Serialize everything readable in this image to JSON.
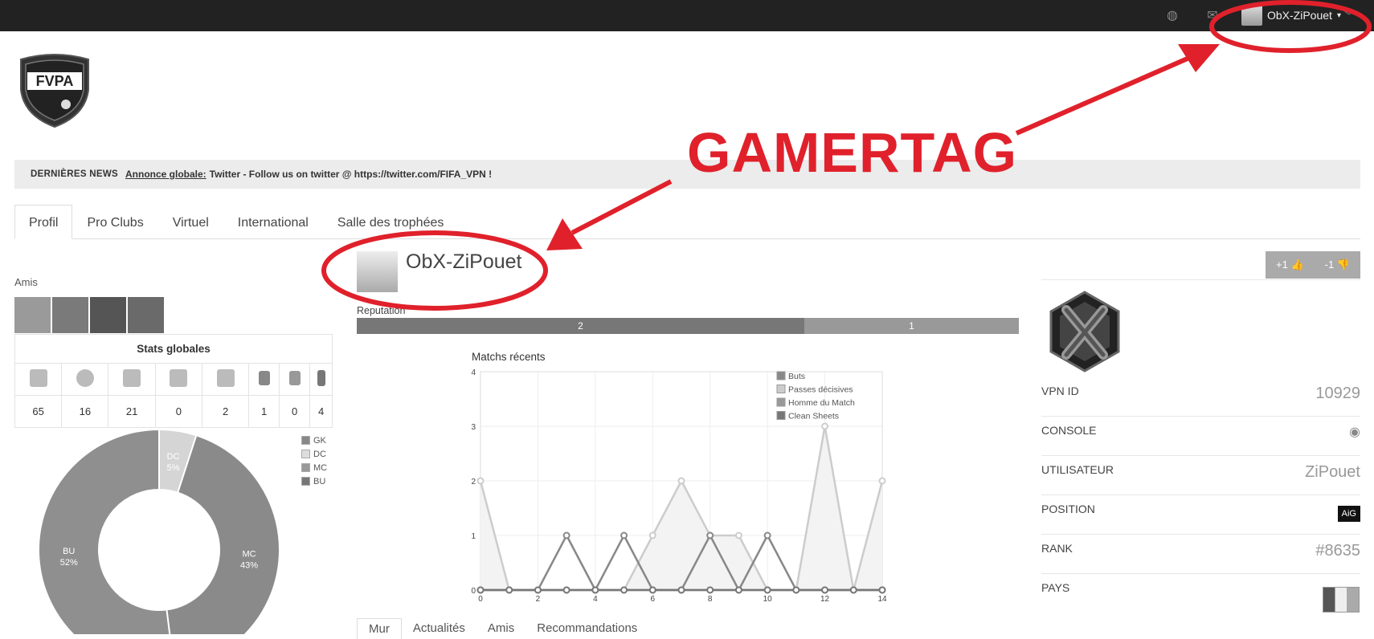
{
  "topbar": {
    "username": "ObX-ZiPouet",
    "caret": "▾"
  },
  "news": {
    "label": "DERNIÈRES NEWS",
    "prefix": "Annonce globale:",
    "text": "Twitter - Follow us on twitter @ https://twitter.com/FIFA_VPN !"
  },
  "tabs": [
    "Profil",
    "Pro Clubs",
    "Virtuel",
    "International",
    "Salle des trophées"
  ],
  "friends": {
    "label": "Amis"
  },
  "stats": {
    "title": "Stats globales",
    "values": [
      "65",
      "16",
      "21",
      "0",
      "2",
      "1",
      "0",
      "4"
    ]
  },
  "donut": {
    "legend": [
      "GK",
      "DC",
      "MC",
      "BU"
    ],
    "slices": [
      {
        "label": "DC",
        "pct": "5%",
        "value": 5,
        "color": "#d5d5d5"
      },
      {
        "label": "MC",
        "pct": "43%",
        "value": 43,
        "color": "#8a8a8a"
      },
      {
        "label": "BU",
        "pct": "52%",
        "value": 52,
        "color": "#8f8f8f"
      }
    ]
  },
  "profile": {
    "name": "ObX-ZiPouet",
    "reputation_label": "Reputation",
    "rep_pos": "2",
    "rep_neg": "1"
  },
  "chart_data": {
    "type": "line",
    "title": "Matchs récents",
    "xlim": [
      0,
      14
    ],
    "ylim": [
      0,
      4
    ],
    "x_ticks": [
      "0",
      "2",
      "4",
      "6",
      "8",
      "10",
      "12",
      "14"
    ],
    "y_ticks": [
      "0",
      "1",
      "2",
      "3",
      "4"
    ],
    "x": [
      0,
      1,
      2,
      3,
      4,
      5,
      6,
      7,
      8,
      9,
      10,
      11,
      12,
      13,
      14
    ],
    "series": [
      {
        "name": "Buts",
        "color": "#888888",
        "values": [
          0,
          0,
          0,
          1,
          0,
          1,
          0,
          0,
          1,
          0,
          1,
          0,
          0,
          0,
          0
        ]
      },
      {
        "name": "Passes décisives",
        "color": "#cccccc",
        "values": [
          2,
          0,
          0,
          0,
          0,
          0,
          1,
          2,
          1,
          1,
          0,
          0,
          3,
          0,
          2
        ]
      },
      {
        "name": "Homme du Match",
        "color": "#999999",
        "values": [
          0,
          0,
          0,
          0,
          0,
          0,
          0,
          0,
          0,
          0,
          0,
          0,
          0,
          0,
          0
        ]
      },
      {
        "name": "Clean Sheets",
        "color": "#777777",
        "values": [
          0,
          0,
          0,
          0,
          0,
          0,
          0,
          0,
          0,
          0,
          0,
          0,
          0,
          0,
          0
        ]
      }
    ]
  },
  "bottom_tabs": [
    "Mur",
    "Actualités",
    "Amis",
    "Recommandations"
  ],
  "vote": {
    "up": "+1",
    "down": "-1"
  },
  "info": [
    {
      "key": "VPN ID",
      "value": "10929"
    },
    {
      "key": "CONSOLE",
      "value": ""
    },
    {
      "key": "UTILISATEUR",
      "value": "ZiPouet"
    },
    {
      "key": "POSITION",
      "value": "AiG"
    },
    {
      "key": "RANK",
      "value": "#8635"
    },
    {
      "key": "PAYS",
      "value": ""
    }
  ],
  "annotation": {
    "text": "GAMERTAG",
    "color": "#e0212b"
  }
}
